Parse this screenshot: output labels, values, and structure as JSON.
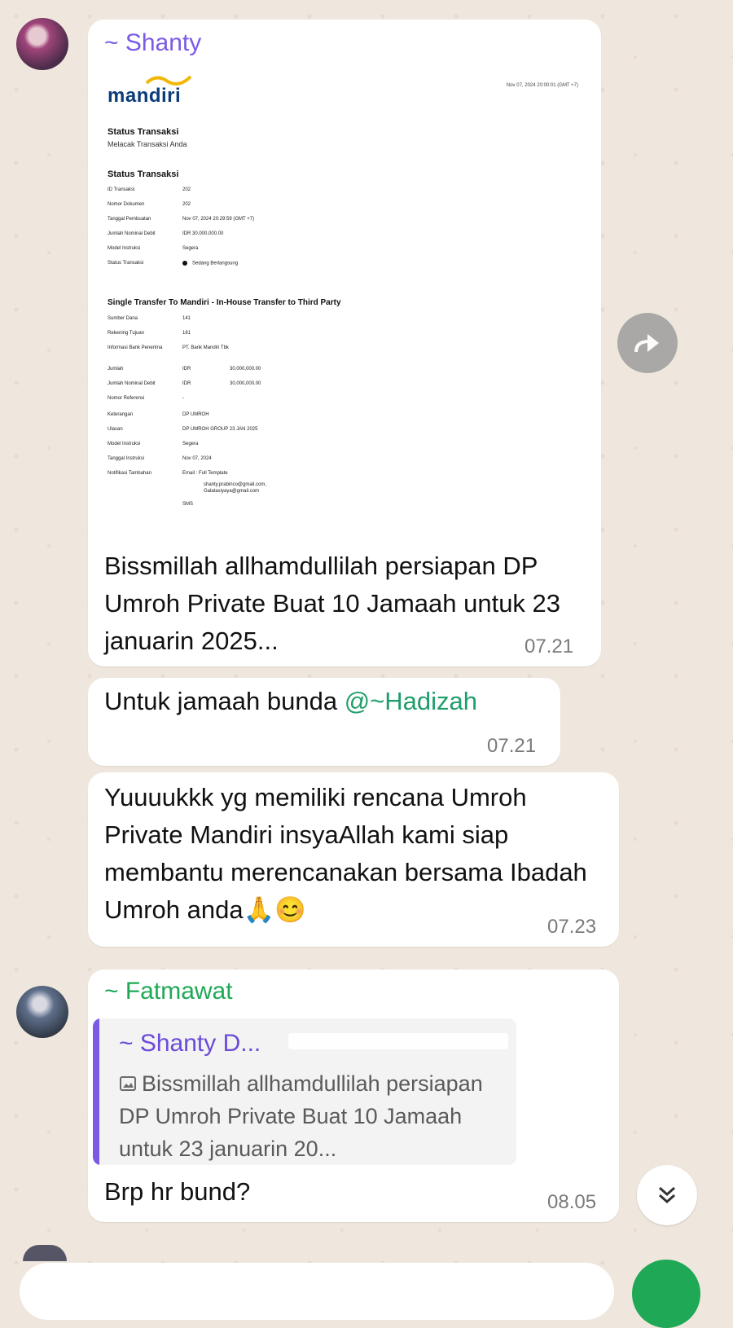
{
  "messages": [
    {
      "sender": "~ Shanty",
      "sender_color": "#7b5be6",
      "image": {
        "brand": "mandiri",
        "date": "Nov 07, 2024 20:00:01 (GMT +7)",
        "title1": "Status Transaksi",
        "subtitle": "Melacak Transaksi Anda",
        "title2": "Status Transaksi",
        "status_rows": [
          {
            "label": "ID Transaksi",
            "value": "202"
          },
          {
            "label": "Nomor Dokumen",
            "value": "202"
          },
          {
            "label": "Tanggal Pembuatan",
            "value": "Nov 07, 2024 20:29:59 (GMT +7)"
          },
          {
            "label": "Jumlah Nominal Debit",
            "value": "IDR 30,000,000.00"
          },
          {
            "label": "Model Instruksi",
            "value": "Segera"
          },
          {
            "label": "Status Transaksi",
            "value": "Sedang Berlangsung"
          }
        ],
        "section_title": "Single Transfer To Mandiri - In-House Transfer to Third Party",
        "transfer_rows": [
          {
            "label": "Sumber Dana",
            "value": "141"
          },
          {
            "label": "Rekening Tujuan",
            "value": "161"
          },
          {
            "label": "Informasi Bank Penerima",
            "value": "PT. Bank Mandiri Tbk"
          },
          {
            "label": "Jumlah",
            "value": "IDR",
            "value2": "30,000,000.00"
          },
          {
            "label": "Jumlah Nominal Debit",
            "value": "IDR",
            "value2": "30,000,000.00"
          },
          {
            "label": "Nomor Referensi",
            "value": "-"
          },
          {
            "label": "Keterangan",
            "value": "DP UMROH"
          },
          {
            "label": "Ulasan",
            "value": "DP UMROH GROUP 23 JAN 2025"
          },
          {
            "label": "Model Instruksi",
            "value": "Segera"
          },
          {
            "label": "Tanggal Instruksi",
            "value": "Nov 07, 2024"
          },
          {
            "label": "Notifikasi Tambahan",
            "value": "Email : Full Template"
          }
        ],
        "emails": [
          "shanty.prabinco@gmail.com,",
          "Galatasiyaya@gmail.com"
        ],
        "sms_label": "SMS"
      },
      "text": "Bissmillah allhamdullilah persiapan DP Umroh Private Buat 10 Jamaah untuk 23 januarin 2025...",
      "time": "07.21"
    },
    {
      "text": "Untuk jamaah bunda ",
      "mention": "@~Hadizah",
      "time": "07.21"
    },
    {
      "text": "Yuuuukkk yg memiliki rencana Umroh Private Mandiri insyaAllah kami siap membantu merencanakan bersama Ibadah Umroh anda",
      "emoji": "🙏😊",
      "time": "07.23"
    },
    {
      "sender": "~ Fatmawat",
      "sender_color": "#1fa855",
      "quote": {
        "name": "~ Shanty D...",
        "icon": "image-icon",
        "text": "Bissmillah allhamdullilah persiapan DP Umroh Private Buat 10 Jamaah untuk 23 januarin 20..."
      },
      "text": "Brp hr bund?",
      "time": "08.05"
    }
  ],
  "icons": {
    "forward": "forward-icon",
    "scroll_down": "double-chevron-down-icon"
  }
}
